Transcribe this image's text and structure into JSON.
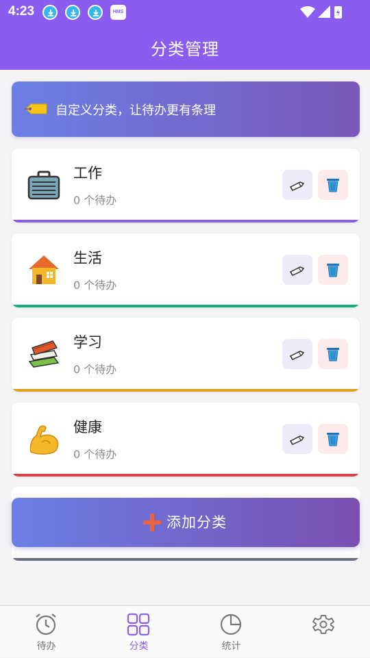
{
  "status_bar": {
    "time": "4:23",
    "hms_badge": "HMS"
  },
  "header": {
    "title": "分类管理"
  },
  "banner": {
    "icon": "label-tag-icon",
    "text": "自定义分类，让待办更有条理"
  },
  "categories": [
    {
      "name": "工作",
      "count": "0 个待办",
      "icon": "briefcase-icon",
      "accent": "#8a5cf0"
    },
    {
      "name": "生活",
      "count": "0 个待办",
      "icon": "house-icon",
      "accent": "#1aaa76"
    },
    {
      "name": "学习",
      "count": "0 个待办",
      "icon": "books-icon",
      "accent": "#e0a020"
    },
    {
      "name": "健康",
      "count": "0 个待办",
      "icon": "flexed-biceps-icon",
      "accent": "#d64545"
    }
  ],
  "actions": {
    "edit_icon": "pencil-icon",
    "delete_icon": "wastebasket-icon"
  },
  "add_button": {
    "label": "添加分类",
    "icon": "plus-icon"
  },
  "tabbar": {
    "tabs": [
      {
        "label": "待办",
        "icon": "alarm-clock-icon",
        "active": false
      },
      {
        "label": "分类",
        "icon": "grid-icon",
        "active": true
      },
      {
        "label": "统计",
        "icon": "pie-chart-icon",
        "active": false
      },
      {
        "label": "",
        "icon": "settings-icon",
        "active": false
      }
    ]
  },
  "colors": {
    "primary": "#8a5cf0",
    "background": "#f4f4f6",
    "banner_gradient": [
      "#6b7fe6",
      "#7a58b8"
    ]
  }
}
